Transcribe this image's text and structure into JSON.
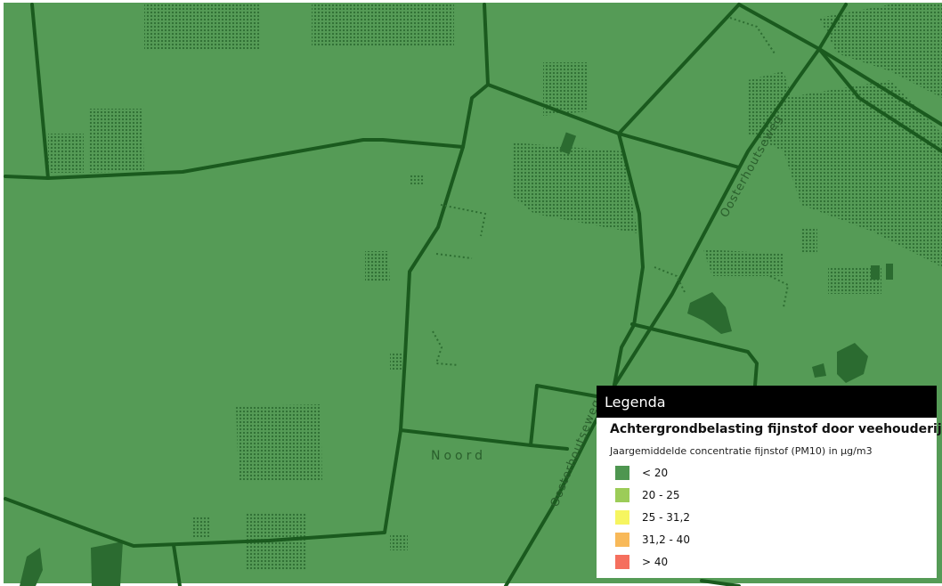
{
  "map": {
    "place_label": "Noord",
    "road_label_1": "Oosterhoutseweg",
    "road_label_2": "Oosterhoutseweg",
    "colors": {
      "background": "#559b56",
      "road": "#1a5a1e",
      "forest": "#3f8443",
      "water": "#2b6b30"
    }
  },
  "legend": {
    "title": "Legenda",
    "layer_title": "Achtergrondbelasting fijnstof door veehouderijen",
    "subtitle": "Jaargemiddelde concentratie fijnstof (PM10) in µg/m3",
    "items": [
      {
        "label": "< 20",
        "color": "#4e9650"
      },
      {
        "label": "20 - 25",
        "color": "#9ccc58"
      },
      {
        "label": "25 - 31,2",
        "color": "#f6f560"
      },
      {
        "label": "31,2 - 40",
        "color": "#f8b959"
      },
      {
        "label": "> 40",
        "color": "#f56f5e"
      }
    ]
  }
}
